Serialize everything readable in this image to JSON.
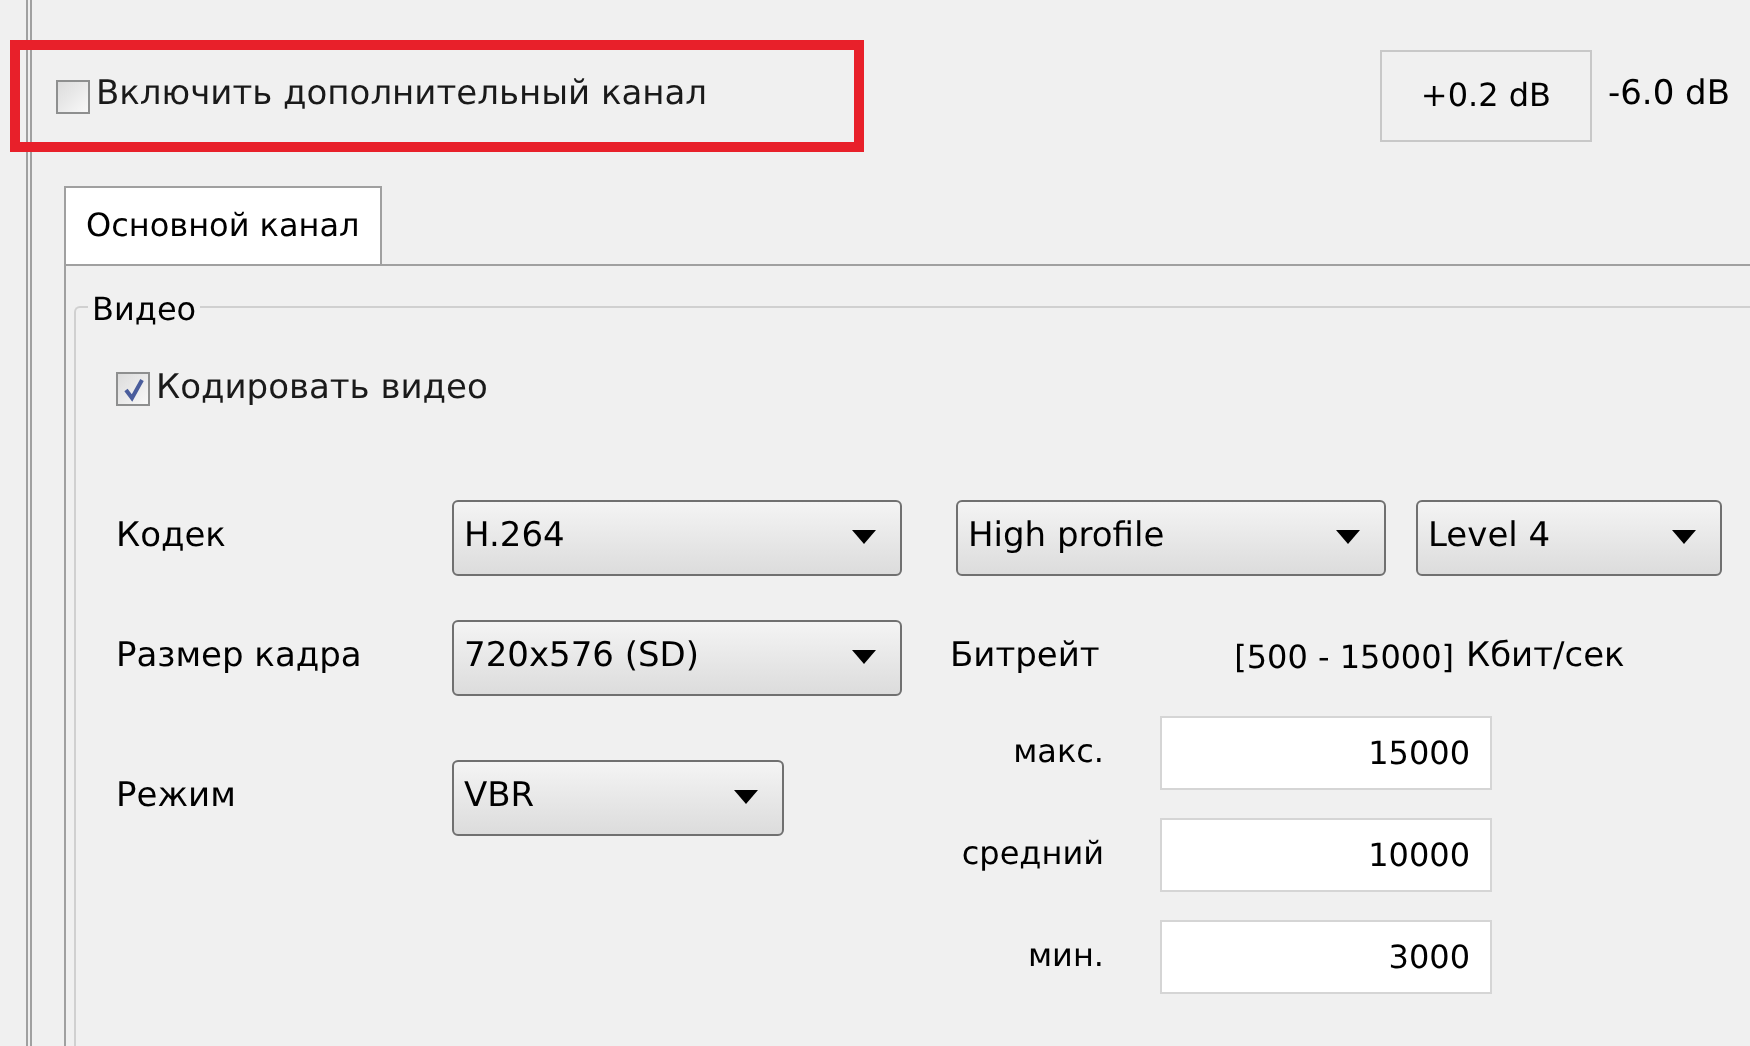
{
  "extra_channel": {
    "label": "Включить дополнительный канал",
    "checked": false,
    "highlighted": true
  },
  "gain": {
    "value": "+0.2 dB",
    "reading": "-6.0 dB"
  },
  "tabs": [
    {
      "label": "Основной канал",
      "selected": true
    }
  ],
  "video": {
    "title": "Видео",
    "encode": {
      "label": "Кодировать видео",
      "checked": true
    },
    "codec": {
      "label": "Кодек",
      "value": "H.264",
      "profile": "High profile",
      "level": "Level 4"
    },
    "frame_size": {
      "label": "Размер кадра",
      "value": "720x576 (SD)"
    },
    "bitrate": {
      "label": "Битрейт",
      "range": "[500 - 15000]",
      "unit": "Кбит/сек"
    },
    "mode": {
      "label": "Режим",
      "value": "VBR"
    },
    "rates": [
      {
        "label": "макс.",
        "value": "15000"
      },
      {
        "label": "средний",
        "value": "10000"
      },
      {
        "label": "мин.",
        "value": "3000"
      }
    ]
  }
}
